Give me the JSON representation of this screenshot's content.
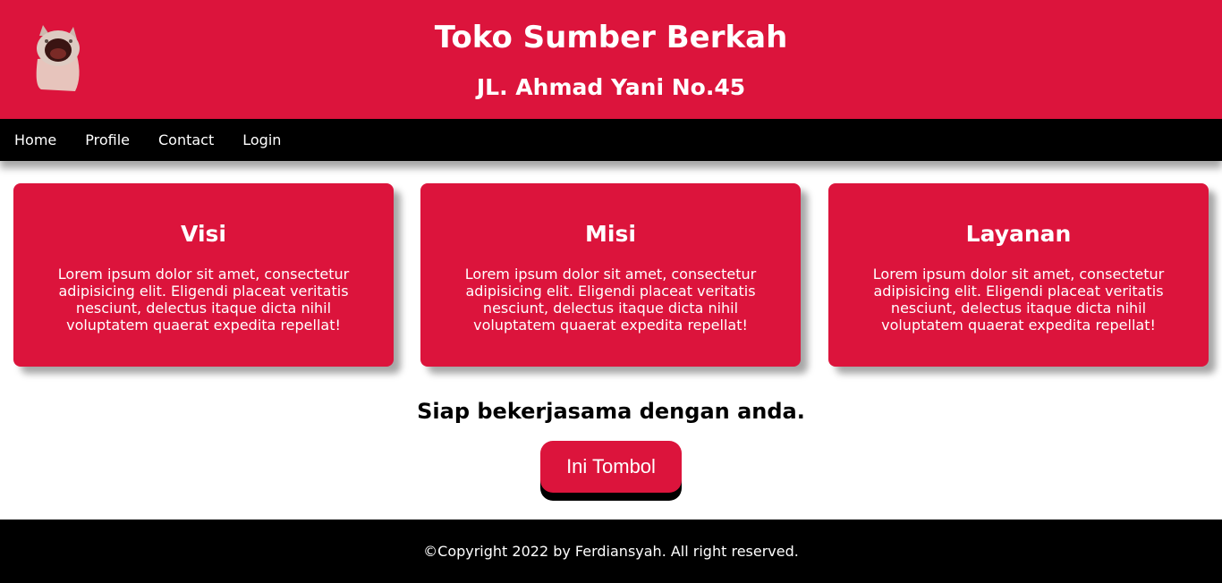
{
  "header": {
    "title": "Toko Sumber Berkah",
    "subtitle": "JL. Ahmad Yani No.45",
    "logo_icon": "screaming-cat-icon",
    "bg_color": "#dc143c"
  },
  "nav": {
    "items": [
      {
        "label": "Home"
      },
      {
        "label": "Profile"
      },
      {
        "label": "Contact"
      },
      {
        "label": "Login"
      }
    ]
  },
  "cards": [
    {
      "title": "Visi",
      "text": "Lorem ipsum dolor sit amet, consectetur adipisicing elit. Eligendi placeat veritatis nesciunt, delectus itaque dicta nihil voluptatem quaerat expedita repellat!"
    },
    {
      "title": "Misi",
      "text": "Lorem ipsum dolor sit amet, consectetur adipisicing elit. Eligendi placeat veritatis nesciunt, delectus itaque dicta nihil voluptatem quaerat expedita repellat!"
    },
    {
      "title": "Layanan",
      "text": "Lorem ipsum dolor sit amet, consectetur adipisicing elit. Eligendi placeat veritatis nesciunt, delectus itaque dicta nihil voluptatem quaerat expedita repellat!"
    }
  ],
  "main": {
    "tagline": "Siap bekerjasama dengan anda.",
    "button_label": "Ini Tombol"
  },
  "footer": {
    "text": "©Copyright 2022 by Ferdiansyah. All right reserved."
  }
}
